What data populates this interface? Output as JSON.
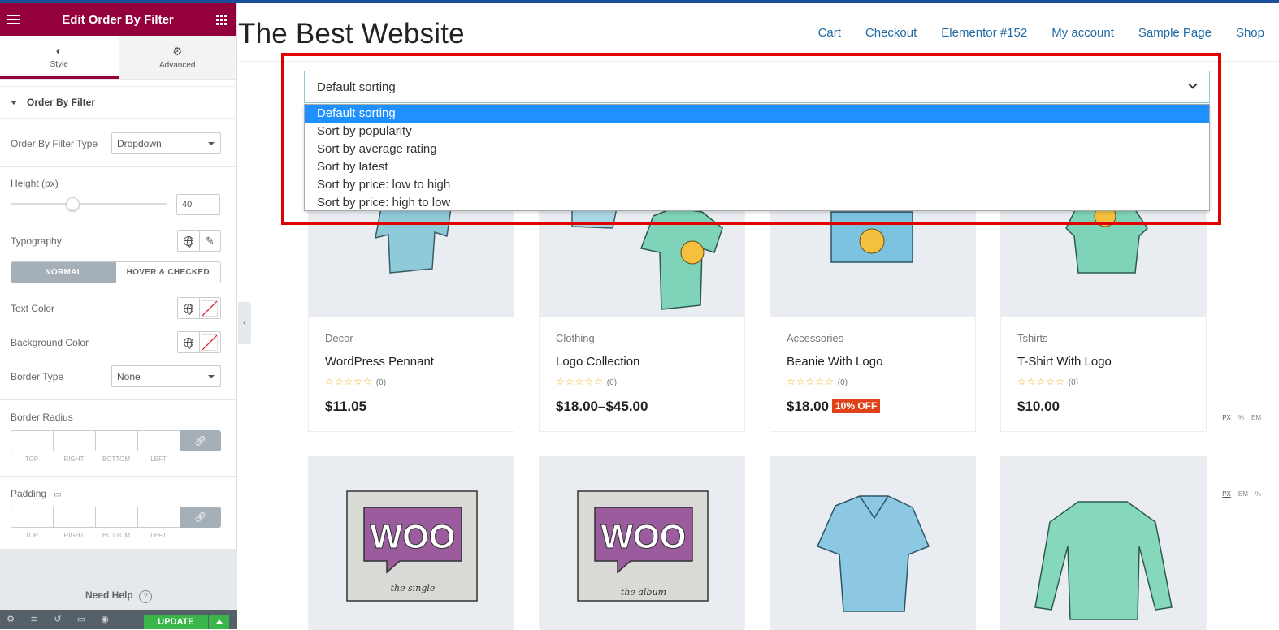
{
  "panel": {
    "title": "Edit Order By Filter",
    "tabs": [
      {
        "label": "Style",
        "icon": "contrast-icon"
      },
      {
        "label": "Advanced",
        "icon": "gear-icon"
      }
    ],
    "section_title": "Order By Filter",
    "filter_type_label": "Order By Filter Type",
    "filter_type_value": "Dropdown",
    "height_label": "Height (px)",
    "height_value": "40",
    "typography_label": "Typography",
    "state_tabs": {
      "normal": "NORMAL",
      "hover": "HOVER & CHECKED"
    },
    "text_color_label": "Text Color",
    "bg_color_label": "Background Color",
    "border_type_label": "Border Type",
    "border_type_value": "None",
    "border_radius_label": "Border Radius",
    "border_radius_units": [
      "PX",
      "%",
      "EM"
    ],
    "padding_label": "Padding",
    "padding_units": [
      "PX",
      "EM",
      "%"
    ],
    "dim_labels": [
      "TOP",
      "RIGHT",
      "BOTTOM",
      "LEFT"
    ],
    "need_help": "Need Help",
    "update_label": "UPDATE"
  },
  "site": {
    "title": "The Best Website",
    "nav": [
      "Cart",
      "Checkout",
      "Elementor #152",
      "My account",
      "Sample Page",
      "Shop"
    ]
  },
  "sort": {
    "selected": "Default sorting",
    "options": [
      "Default sorting",
      "Sort by popularity",
      "Sort by average rating",
      "Sort by latest",
      "Sort by price: low to high",
      "Sort by price: high to low"
    ]
  },
  "products": [
    {
      "category": "Decor",
      "name": "WordPress Pennant",
      "stars": "☆☆☆☆☆",
      "rating_count": "(0)",
      "price": "$11.05",
      "badge": ""
    },
    {
      "category": "Clothing",
      "name": "Logo Collection",
      "stars": "☆☆☆☆☆",
      "rating_count": "(0)",
      "price": "$18.00–$45.00",
      "badge": ""
    },
    {
      "category": "Accessories",
      "name": "Beanie With Logo",
      "stars": "☆☆☆☆☆",
      "rating_count": "(0)",
      "price": "$18.00",
      "badge": "10% OFF"
    },
    {
      "category": "Tshirts",
      "name": "T-Shirt With Logo",
      "stars": "☆☆☆☆☆",
      "rating_count": "(0)",
      "price": "$10.00",
      "badge": ""
    }
  ],
  "second_row": [
    {
      "image": "woo-single-art",
      "caption": "the single"
    },
    {
      "image": "woo-album-art",
      "caption": "the album"
    },
    {
      "image": "polo-shirt"
    },
    {
      "image": "long-sleeve-tee"
    }
  ],
  "colors": {
    "panel_brand": "#93003c",
    "link": "#1f6aa5",
    "highlight": "#e00000",
    "select_highlight": "#1e90ff",
    "badge": "#e0421a",
    "update": "#39b54a"
  }
}
